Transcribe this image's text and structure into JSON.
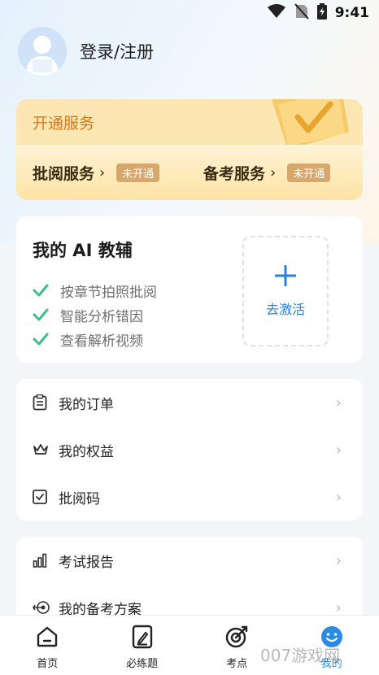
{
  "status_bar": {
    "time": "9:41",
    "icons": [
      "wifi-icon",
      "no-sim-icon",
      "battery-icon"
    ]
  },
  "profile": {
    "name": "登录/注册"
  },
  "service": {
    "title": "开通服务",
    "items": [
      {
        "label": "批阅服务",
        "badge": "未开通"
      },
      {
        "label": "备考服务",
        "badge": "未开通"
      }
    ]
  },
  "ai_tutor": {
    "title": "我的 AI 教辅",
    "features": [
      "按章节拍照批阅",
      "智能分析错因",
      "查看解析视频"
    ],
    "activate_label": "去激活"
  },
  "menu1": [
    {
      "label": "我的订单",
      "icon": "clipboard-icon"
    },
    {
      "label": "我的权益",
      "icon": "crown-icon"
    },
    {
      "label": "批阅码",
      "icon": "checkbox-icon"
    }
  ],
  "menu2": [
    {
      "label": "考试报告",
      "icon": "bar-chart-icon"
    },
    {
      "label": "我的备考方案",
      "icon": "target-icon"
    }
  ],
  "tabs": [
    {
      "label": "首页",
      "icon": "home-icon"
    },
    {
      "label": "必练题",
      "icon": "edit-icon"
    },
    {
      "label": "考点",
      "icon": "target-icon"
    },
    {
      "label": "我的",
      "icon": "smiley-icon"
    }
  ],
  "watermark": "007游戏网",
  "colors": {
    "accent": "#2a8be6",
    "service_text": "#d47a1c",
    "badge": "#d9a76b",
    "check": "#3bbf8c"
  }
}
